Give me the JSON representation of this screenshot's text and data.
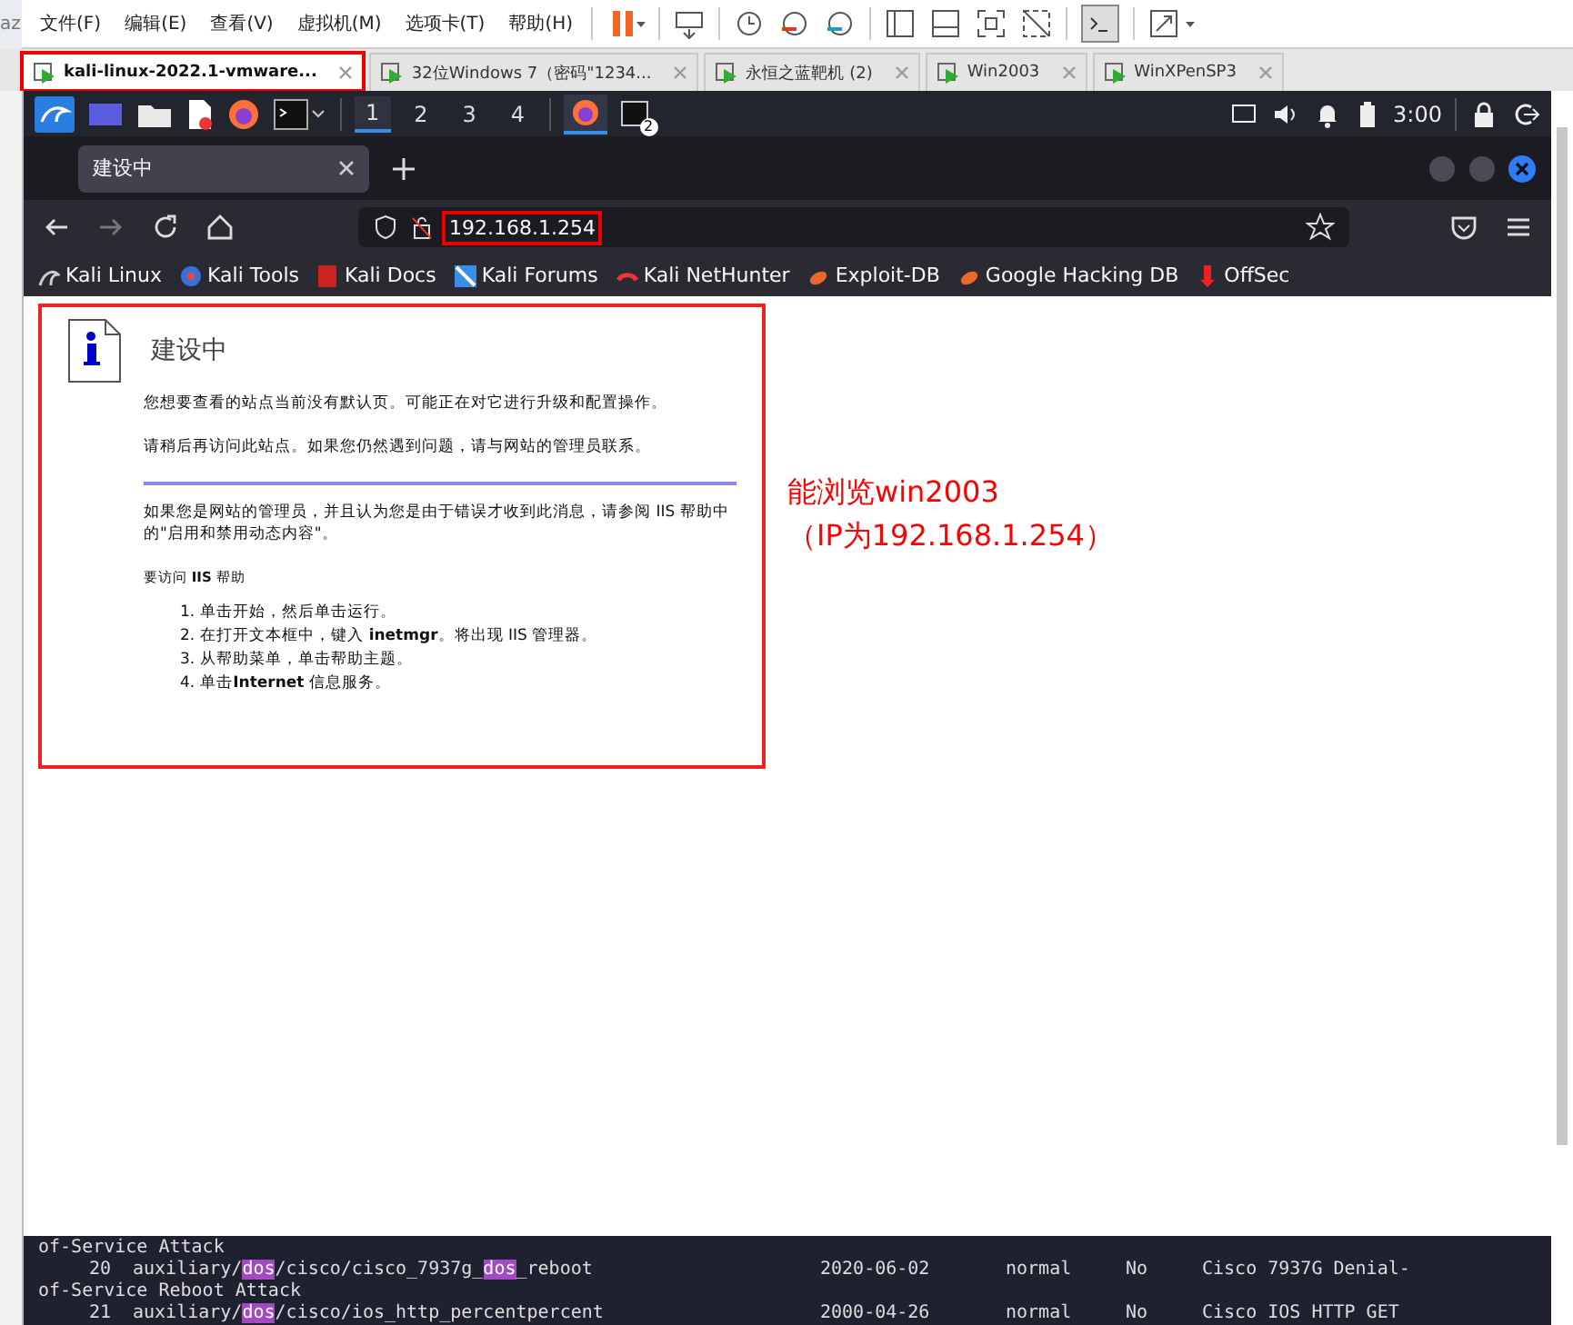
{
  "outer_edge_text": "az",
  "menu": [
    "文件(F)",
    "编辑(E)",
    "查看(V)",
    "虚拟机(M)",
    "选项卡(T)",
    "帮助(H)"
  ],
  "vm_tabs": [
    {
      "label": "kali-linux-2022.1-vmware...",
      "selected": true,
      "annotated": true
    },
    {
      "label": "32位Windows 7（密码\"1234...",
      "selected": false,
      "annotated": false
    },
    {
      "label": "永恒之蓝靶机 (2)",
      "selected": false,
      "annotated": false
    },
    {
      "label": "Win2003",
      "selected": false,
      "annotated": false
    },
    {
      "label": "WinXPenSP3",
      "selected": false,
      "annotated": false
    }
  ],
  "panel": {
    "workspaces": [
      {
        "label": "1",
        "selected": true
      },
      {
        "label": "2",
        "selected": false
      },
      {
        "label": "3",
        "selected": false
      },
      {
        "label": "4",
        "selected": false
      }
    ],
    "terminal_badge": "2",
    "clock": "3:00"
  },
  "browser": {
    "tab_title": "建设中",
    "url": "192.168.1.254",
    "url_annotated": true,
    "bookmarks": [
      {
        "label": "Kali Linux",
        "kind": "dragon"
      },
      {
        "label": "Kali Tools",
        "kind": "tools"
      },
      {
        "label": "Kali Docs",
        "kind": "docs"
      },
      {
        "label": "Kali Forums",
        "kind": "forums"
      },
      {
        "label": "Kali NetHunter",
        "kind": "nethunter"
      },
      {
        "label": "Exploit-DB",
        "kind": "bug"
      },
      {
        "label": "Google Hacking DB",
        "kind": "bug"
      },
      {
        "label": "OffSec",
        "kind": "offsec"
      }
    ]
  },
  "page": {
    "annotated": true,
    "title": "建设中",
    "paragraphs": [
      "您想要查看的站点当前没有默认页。可能正在对它进行升级和配置操作。",
      "请稍后再访问此站点。如果您仍然遇到问题，请与网站的管理员联系。"
    ],
    "admin_note": "如果您是网站的管理员，并且认为您是由于错误才收到此消息，请参阅 IIS 帮助中的\"启用和禁用动态内容\"。",
    "help_heading": "要访问 **IIS** 帮助",
    "steps": [
      {
        "marker": "1.",
        "text": "单击开始，然后单击运行。"
      },
      {
        "marker": "2.",
        "text": "在打开文本框中，键入 **inetmgr**。将出现 IIS 管理器。"
      },
      {
        "marker": "3.",
        "text": "从帮助菜单，单击帮助主题。"
      },
      {
        "marker": "4.",
        "text": "单击**Internet** 信息服务。"
      }
    ]
  },
  "annotation": [
    "能浏览win2003",
    "（IP为192.168.1.254）"
  ],
  "terminal": [
    {
      "kind": "wrap",
      "text": "of-Service Attack"
    },
    {
      "kind": "row",
      "number": "20",
      "module": [
        {
          "text": "auxiliary/",
          "highlight": false
        },
        {
          "text": "dos",
          "highlight": true
        },
        {
          "text": "/cisco/cisco_7937g_",
          "highlight": false
        },
        {
          "text": "dos",
          "highlight": true
        },
        {
          "text": "_reboot",
          "highlight": false
        }
      ],
      "date": "2020-06-02",
      "rank": "normal",
      "check": "No",
      "description": "Cisco 7937G Denial-"
    },
    {
      "kind": "wrap",
      "text": "of-Service Reboot Attack"
    },
    {
      "kind": "row",
      "number": "21",
      "module": [
        {
          "text": "auxiliary/",
          "highlight": false
        },
        {
          "text": "dos",
          "highlight": true
        },
        {
          "text": "/cisco/ios_http_percentpercent",
          "highlight": false
        }
      ],
      "date": "2000-04-26",
      "rank": "normal",
      "check": "No",
      "description": "Cisco IOS HTTP GET"
    }
  ]
}
